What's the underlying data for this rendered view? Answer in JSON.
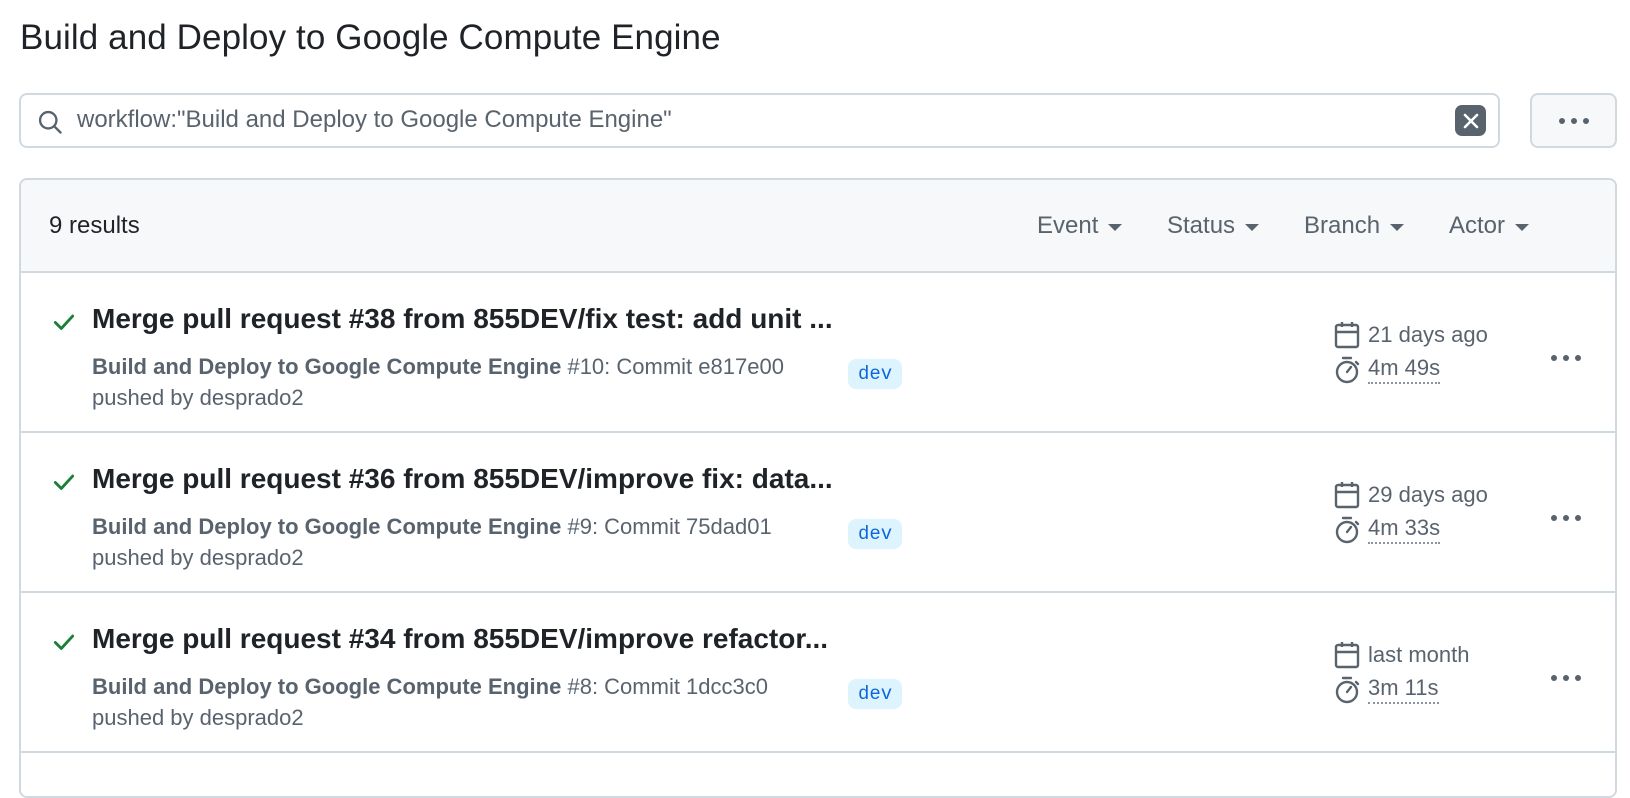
{
  "page": {
    "title": "Build and Deploy to Google Compute Engine"
  },
  "search": {
    "value": "workflow:\"Build and Deploy to Google Compute Engine\""
  },
  "results": {
    "count_label": "9 results",
    "filters": {
      "event": "Event",
      "status": "Status",
      "branch": "Branch",
      "actor": "Actor"
    }
  },
  "runs": [
    {
      "title": "Merge pull request #38 from 855DEV/fix test: add unit ...",
      "workflow": "Build and Deploy to Google Compute Engine",
      "run_number": "#10",
      "commit_text": ": Commit e817e00 pushed by desprado2",
      "branch": "dev",
      "date": "21 days ago",
      "duration": "4m 49s",
      "status": "success"
    },
    {
      "title": "Merge pull request #36 from 855DEV/improve fix: data...",
      "workflow": "Build and Deploy to Google Compute Engine",
      "run_number": "#9",
      "commit_text": ": Commit 75dad01 pushed by desprado2",
      "branch": "dev",
      "date": "29 days ago",
      "duration": "4m 33s",
      "status": "success"
    },
    {
      "title": "Merge pull request #34 from 855DEV/improve refactor...",
      "workflow": "Build and Deploy to Google Compute Engine",
      "run_number": "#8",
      "commit_text": ": Commit 1dcc3c0 pushed by desprado2",
      "branch": "dev",
      "date": "last month",
      "duration": "3m 11s",
      "status": "success"
    }
  ],
  "colors": {
    "success": "#1a7f37",
    "accent": "#0969da",
    "muted": "#59636e"
  }
}
